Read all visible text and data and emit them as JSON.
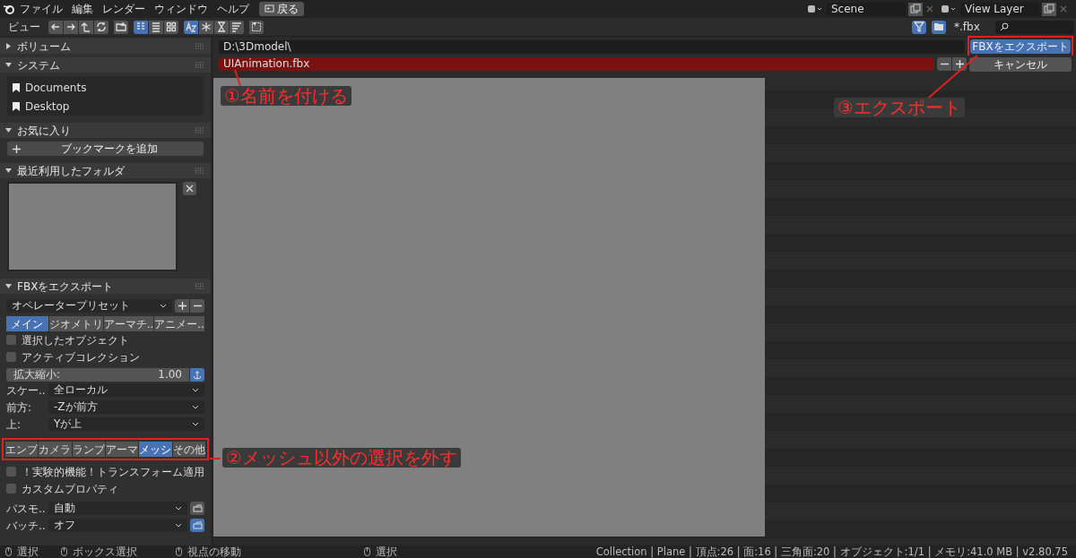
{
  "topbar": {
    "menus": [
      "ファイル",
      "編集",
      "レンダー",
      "ウィンドウ",
      "ヘルプ"
    ],
    "back_button": "戻る",
    "scene": "Scene",
    "view_layer": "View Layer"
  },
  "toolbar": {
    "view_menu": "ビュー",
    "display_modes": [
      {
        "selected": true
      },
      {
        "selected": false
      },
      {
        "selected": false
      }
    ],
    "sort_modes": [
      {
        "selected": true
      },
      {
        "selected": false
      },
      {
        "selected": false
      },
      {
        "selected": false
      }
    ],
    "filter_on": true,
    "filter_text": "*.fbx"
  },
  "path": "D:\\3Dmodel\\",
  "filename": "UIAnimation.fbx",
  "filename_exists": true,
  "export_button": "FBXをエクスポート",
  "cancel_button": "キャンセル",
  "sidebar": {
    "panels": [
      {
        "kind": "volumes",
        "title": "ボリューム",
        "expanded": false
      },
      {
        "kind": "system",
        "title": "システム",
        "expanded": true,
        "items": [
          "Documents",
          "Desktop"
        ]
      },
      {
        "kind": "favorites",
        "title": "お気に入り",
        "expanded": true,
        "button": "ブックマークを追加"
      },
      {
        "kind": "recent",
        "title": "最近利用したフォルダ",
        "expanded": true
      },
      {
        "kind": "export",
        "title": "FBXをエクスポート",
        "expanded": true
      }
    ]
  },
  "export": {
    "preset": "オペレータープリセット",
    "tabs": [
      {
        "label": "メイン",
        "selected": true
      },
      {
        "label": "ジオメトリ",
        "selected": false
      },
      {
        "label": "アーマチ..",
        "selected": false
      },
      {
        "label": "アニメー..",
        "selected": false
      }
    ],
    "checks": [
      {
        "label": "選択したオブジェクト",
        "checked": false
      },
      {
        "label": "アクティブコレクション",
        "checked": false
      }
    ],
    "scale": {
      "label": "拡大縮小:",
      "value": "1.00",
      "apply_unit": true
    },
    "dropdowns": [
      {
        "label": "スケー..",
        "value": "全ローカル"
      },
      {
        "label": "前方:",
        "value": "-Zが前方"
      },
      {
        "label": "上:",
        "value": "Yが上"
      }
    ],
    "object_types": [
      {
        "label": "エンプ",
        "selected": false
      },
      {
        "label": "カメラ",
        "selected": false
      },
      {
        "label": "ランプ",
        "selected": false
      },
      {
        "label": "アーマ",
        "selected": false
      },
      {
        "label": "メッシ",
        "selected": true
      },
      {
        "label": "その他",
        "selected": false
      }
    ],
    "checks2": [
      {
        "label": "！実験的機能！トランスフォーム適用",
        "checked": false
      },
      {
        "label": "カスタムプロパティ",
        "checked": false
      }
    ],
    "dropdowns2": [
      {
        "label": "パスモ..",
        "value": "自動",
        "toggle": false
      },
      {
        "label": "バッチ..",
        "value": "オフ",
        "toggle": true
      }
    ]
  },
  "status_bar": {
    "hints": [
      "選択",
      "ボックス選択",
      "視点の移動",
      "選択"
    ],
    "stats": "Collection | Plane | 頂点:26 | 面:16 | 三角面:20 | オブジェクト:1/1 | メモリ:41.0 MB | v2.80.75"
  },
  "annotations": [
    {
      "text": "①名前を付ける"
    },
    {
      "text": "②メッシュ以外の選択を外す"
    },
    {
      "text": "③エクスポート"
    }
  ]
}
